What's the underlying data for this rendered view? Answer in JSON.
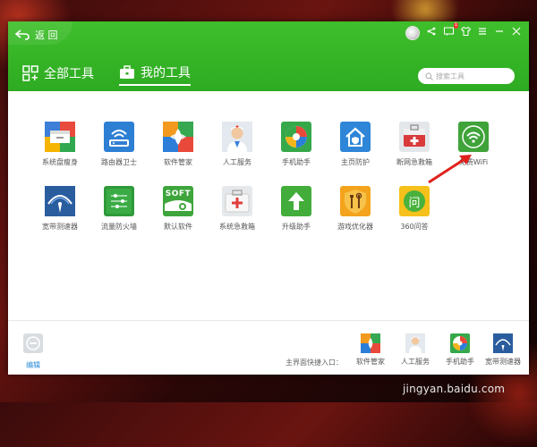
{
  "header": {
    "back_label": "返 回",
    "tabs": [
      {
        "label": "全部工具",
        "active": false,
        "icon": "grid-icon"
      },
      {
        "label": "我的工具",
        "active": true,
        "icon": "toolbox-icon"
      }
    ],
    "search_placeholder": "搜索工具",
    "notification_count": "1"
  },
  "tools": [
    {
      "label": "系统盘瘦身",
      "icon": "drawer-icon"
    },
    {
      "label": "路由器卫士",
      "icon": "router-icon"
    },
    {
      "label": "软件管家",
      "icon": "software-manager-icon"
    },
    {
      "label": "人工服务",
      "icon": "doctor-icon"
    },
    {
      "label": "手机助手",
      "icon": "phone-assistant-icon"
    },
    {
      "label": "主页防护",
      "icon": "home-shield-icon"
    },
    {
      "label": "断网急救箱",
      "icon": "first-aid-icon"
    },
    {
      "label": "免费WiFi",
      "icon": "wifi-icon"
    },
    {
      "label": "宽带测速器",
      "icon": "speedometer-icon"
    },
    {
      "label": "流量防火墙",
      "icon": "firewall-icon"
    },
    {
      "label": "默认软件",
      "icon": "soft-icon"
    },
    {
      "label": "系统急救箱",
      "icon": "system-rescue-icon"
    },
    {
      "label": "升级助手",
      "icon": "upgrade-arrow-icon"
    },
    {
      "label": "游戏优化器",
      "icon": "game-optimizer-icon"
    },
    {
      "label": "360问答",
      "icon": "qa-icon"
    }
  ],
  "soft_icon_text": "SOFT",
  "qa_icon_text": "问",
  "footer": {
    "edit_label": "编辑",
    "quick_entry_label": "主界面快捷入口：",
    "quick_items": [
      {
        "label": "软件管家"
      },
      {
        "label": "人工服务"
      },
      {
        "label": "手机助手"
      },
      {
        "label": "宽带测速器"
      }
    ]
  },
  "watermark": "jingyan.baidu.com",
  "colors": {
    "header_green": "#35b526",
    "wifi_green": "#3fa33a",
    "arrow_red": "#e0201a"
  }
}
